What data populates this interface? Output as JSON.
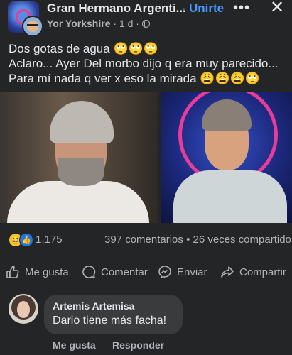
{
  "header": {
    "group_name": "Gran Hermano Argenti...",
    "separator": "·",
    "join_label": "Unirte",
    "more_icon": "more-dots-icon",
    "close_icon": "close-icon",
    "author": "Yor Yorkshire",
    "timestamp": "1 d",
    "privacy_icon": "globe-icon"
  },
  "post": {
    "lines": [
      "Dos gotas de agua 🙄🙄🙄",
      "Aclaro... Ayer Del morbo dijo q era muy parecido...",
      "Para mí nada q ver x eso la mirada 😩😩😩🙄"
    ]
  },
  "stats": {
    "reactions": [
      "😆",
      "👍"
    ],
    "reaction_count": "1,175",
    "comments_shares": "397 comentarios • 26 veces compartido"
  },
  "actions": {
    "like": "Me gusta",
    "comment": "Comentar",
    "send": "Enviar",
    "share": "Compartir"
  },
  "comment": {
    "author": "Artemis Artemisa",
    "text": "Dario tiene más facha!",
    "like_label": "Me gusta",
    "reply_label": "Responder"
  },
  "colors": {
    "background": "#242526",
    "text": "#e4e6eb",
    "secondary": "#b0b3b8",
    "accent": "#4599ff",
    "bubble": "#3a3b3c"
  }
}
